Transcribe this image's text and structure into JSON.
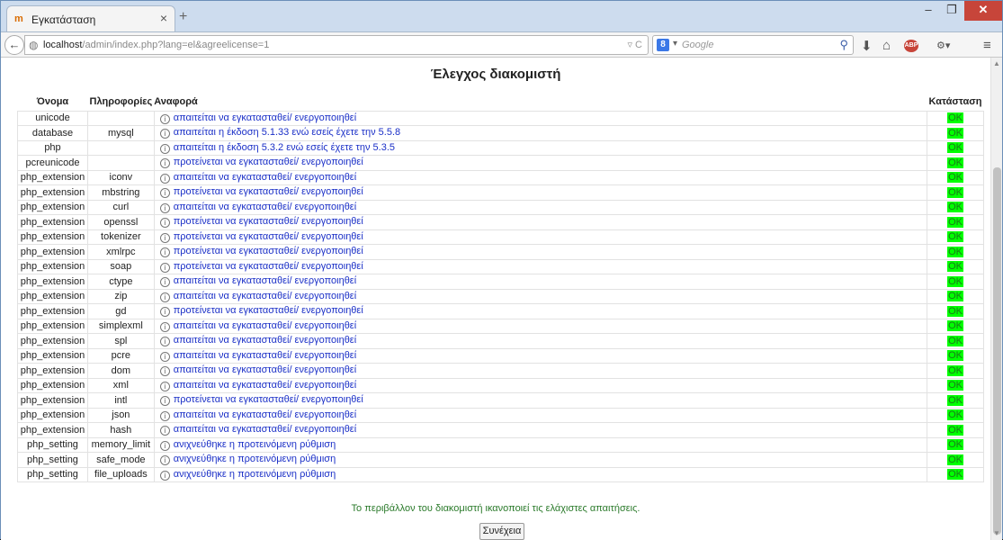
{
  "browser": {
    "tab_title": "Εγκατάσταση",
    "tab_close": "×",
    "new_tab": "+",
    "win_min": "–",
    "win_max": "❐",
    "win_close": "✕",
    "url_host": "localhost",
    "url_path": "/admin/index.php?lang=el&agreelicense=1",
    "search_engine_letter": "8",
    "search_placeholder": "Google",
    "abp_label": "ABP"
  },
  "page": {
    "title": "Έλεγχος διακομιστή",
    "columns": [
      "Όνομα",
      "Πληροφορίες",
      "Αναφορά",
      "Κατάσταση"
    ],
    "rows": [
      {
        "name": "unicode",
        "info": "",
        "report": "απαιτείται να εγκατασταθεί/ ενεργοποιηθεί",
        "status": "OK"
      },
      {
        "name": "database",
        "info": "mysql",
        "report": "απαιτείται η έκδοση 5.1.33 ενώ εσείς έχετε την 5.5.8",
        "status": "OK"
      },
      {
        "name": "php",
        "info": "",
        "report": "απαιτείται η έκδοση 5.3.2 ενώ εσείς έχετε την 5.3.5",
        "status": "OK"
      },
      {
        "name": "pcreunicode",
        "info": "",
        "report": "προτείνεται να εγκατασταθεί/ ενεργοποιηθεί",
        "status": "OK"
      },
      {
        "name": "php_extension",
        "info": "iconv",
        "report": "απαιτείται να εγκατασταθεί/ ενεργοποιηθεί",
        "status": "OK"
      },
      {
        "name": "php_extension",
        "info": "mbstring",
        "report": "προτείνεται να εγκατασταθεί/ ενεργοποιηθεί",
        "status": "OK"
      },
      {
        "name": "php_extension",
        "info": "curl",
        "report": "απαιτείται να εγκατασταθεί/ ενεργοποιηθεί",
        "status": "OK"
      },
      {
        "name": "php_extension",
        "info": "openssl",
        "report": "προτείνεται να εγκατασταθεί/ ενεργοποιηθεί",
        "status": "OK"
      },
      {
        "name": "php_extension",
        "info": "tokenizer",
        "report": "προτείνεται να εγκατασταθεί/ ενεργοποιηθεί",
        "status": "OK"
      },
      {
        "name": "php_extension",
        "info": "xmlrpc",
        "report": "προτείνεται να εγκατασταθεί/ ενεργοποιηθεί",
        "status": "OK"
      },
      {
        "name": "php_extension",
        "info": "soap",
        "report": "προτείνεται να εγκατασταθεί/ ενεργοποιηθεί",
        "status": "OK"
      },
      {
        "name": "php_extension",
        "info": "ctype",
        "report": "απαιτείται να εγκατασταθεί/ ενεργοποιηθεί",
        "status": "OK"
      },
      {
        "name": "php_extension",
        "info": "zip",
        "report": "απαιτείται να εγκατασταθεί/ ενεργοποιηθεί",
        "status": "OK"
      },
      {
        "name": "php_extension",
        "info": "gd",
        "report": "προτείνεται να εγκατασταθεί/ ενεργοποιηθεί",
        "status": "OK"
      },
      {
        "name": "php_extension",
        "info": "simplexml",
        "report": "απαιτείται να εγκατασταθεί/ ενεργοποιηθεί",
        "status": "OK"
      },
      {
        "name": "php_extension",
        "info": "spl",
        "report": "απαιτείται να εγκατασταθεί/ ενεργοποιηθεί",
        "status": "OK"
      },
      {
        "name": "php_extension",
        "info": "pcre",
        "report": "απαιτείται να εγκατασταθεί/ ενεργοποιηθεί",
        "status": "OK"
      },
      {
        "name": "php_extension",
        "info": "dom",
        "report": "απαιτείται να εγκατασταθεί/ ενεργοποιηθεί",
        "status": "OK"
      },
      {
        "name": "php_extension",
        "info": "xml",
        "report": "απαιτείται να εγκατασταθεί/ ενεργοποιηθεί",
        "status": "OK"
      },
      {
        "name": "php_extension",
        "info": "intl",
        "report": "προτείνεται να εγκατασταθεί/ ενεργοποιηθεί",
        "status": "OK"
      },
      {
        "name": "php_extension",
        "info": "json",
        "report": "απαιτείται να εγκατασταθεί/ ενεργοποιηθεί",
        "status": "OK"
      },
      {
        "name": "php_extension",
        "info": "hash",
        "report": "απαιτείται να εγκατασταθεί/ ενεργοποιηθεί",
        "status": "OK"
      },
      {
        "name": "php_setting",
        "info": "memory_limit",
        "report": "ανιχνεύθηκε η προτεινόμενη ρύθμιση",
        "status": "OK"
      },
      {
        "name": "php_setting",
        "info": "safe_mode",
        "report": "ανιχνεύθηκε η προτεινόμενη ρύθμιση",
        "status": "OK"
      },
      {
        "name": "php_setting",
        "info": "file_uploads",
        "report": "ανιχνεύθηκε η προτεινόμενη ρύθμιση",
        "status": "OK"
      }
    ],
    "summary": "Το περιβάλλον του διακομιστή ικανοποιεί τις ελάχιστες απαιτήσεις.",
    "continue_label": "Συνέχεια"
  },
  "colors": {
    "ok_bg": "#00ff00",
    "link": "#1a2fc7",
    "summary": "#2a7a2a"
  }
}
